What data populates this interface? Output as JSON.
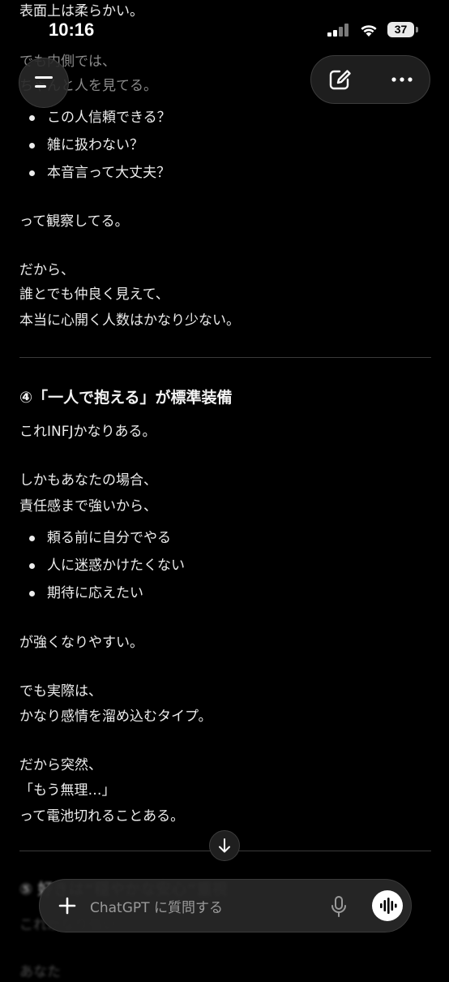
{
  "status_bar": {
    "time": "10:16",
    "battery": "37"
  },
  "message": {
    "top_line": "表面上は柔らかい。",
    "partial_1": "でも内側では、",
    "partial_2": "ちゃんと人を見てる。",
    "bullets_a": [
      "この人信頼できる？",
      "雑に扱わない？",
      "本音言って大丈夫？"
    ],
    "observe": "って観察してる。",
    "so_1": "だから、",
    "so_2": "誰とでも仲良く見えて、",
    "so_3": "本当に心開く人数はかなり少ない。",
    "section4_heading": "④「一人で抱える」が標準装備",
    "s4_p1": "これINFJかなりある。",
    "s4_p2a": "しかもあなたの場合、",
    "s4_p2b": "責任感まで強いから、",
    "bullets_b": [
      "頼る前に自分でやる",
      "人に迷惑かけたくない",
      "期待に応えたい"
    ],
    "s4_p3": "が強くなりやすい。",
    "s4_p4a": "でも実際は、",
    "s4_p4b": "かなり感情を溜め込むタイプ。",
    "s4_p5a": "だから突然、",
    "s4_p5b": "「もう無理…」",
    "s4_p5c": "って電池切れることある。",
    "section5_heading": "⑤ 好きは“穏やかな安心”重視",
    "s5_partial_1": "これかなり強い。",
    "s5_partial_2": "あなた"
  },
  "composer": {
    "placeholder": "ChatGPT に質問する"
  },
  "icons": {
    "menu": "menu-icon",
    "new_chat": "edit-icon",
    "more": "more-icon",
    "scroll": "arrow-down-icon",
    "add": "plus-icon",
    "mic": "mic-icon",
    "voice": "voice-wave-icon"
  }
}
